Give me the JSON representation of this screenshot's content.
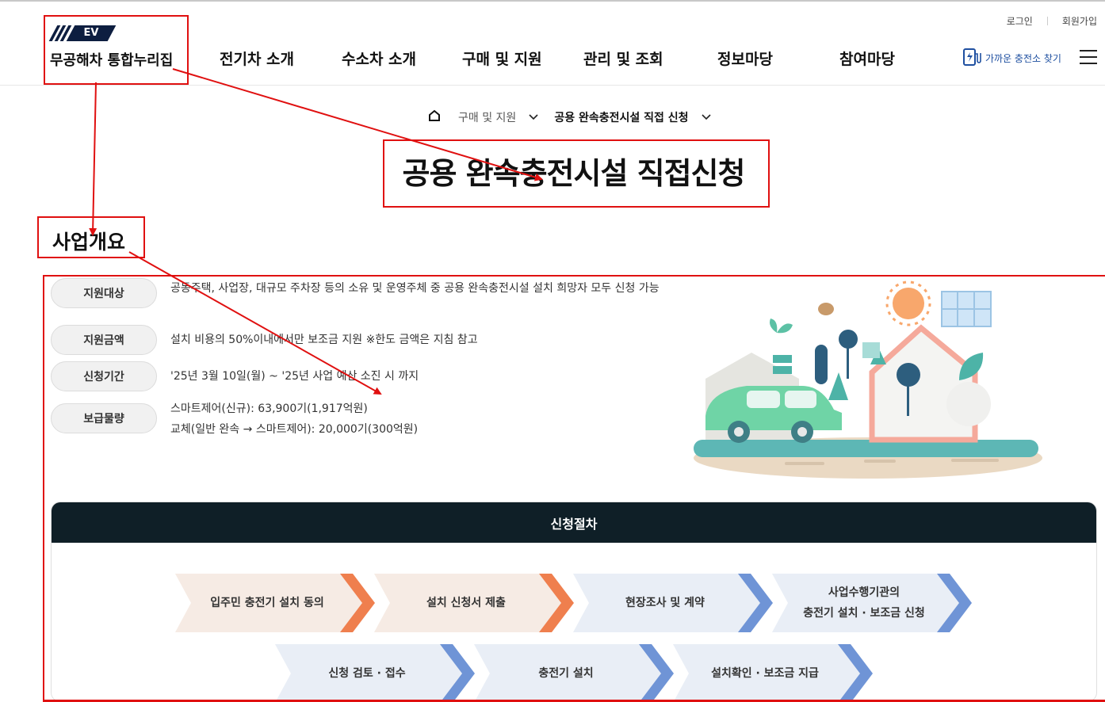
{
  "header": {
    "logo_badge": "EV",
    "logo_text": "무공해차 통합누리집",
    "util": {
      "login": "로그인",
      "signup": "회원가입"
    },
    "nav": [
      "전기차 소개",
      "수소차 소개",
      "구매 및 지원",
      "관리 및 조회",
      "정보마당",
      "참여마당"
    ],
    "charger_find": "가까운 충전소 찾기"
  },
  "breadcrumb": {
    "item1": "구매 및 지원",
    "item2": "공용 완속충전시설 직접 신청"
  },
  "page_title": "공용 완속충전시설 직접신청",
  "section_title": "사업개요",
  "overview": [
    {
      "label": "지원대상",
      "desc": "공동주택, 사업장, 대규모 주차장 등의 소유 및 운영주체 중 공용 완속충전시설 설치 희망자 모두 신청 가능"
    },
    {
      "label": "지원금액",
      "desc": "설치 비용의 50%이내에서만 보조금 지원 ※한도 금액은 지침 참고"
    },
    {
      "label": "신청기간",
      "desc": "'25년 3월 10일(월) ~ '25년 사업 예산 소진 시 까지"
    },
    {
      "label": "보급물량",
      "desc_line1": "스마트제어(신규): 63,900기(1,917억원)",
      "desc_line2": "교체(일반 완속 → 스마트제어): 20,000기(300억원)"
    }
  ],
  "process": {
    "title": "신청절차",
    "steps": [
      {
        "line1": "입주민 충전기 설치 동의",
        "line2": ""
      },
      {
        "line1": "설치 신청서 제출",
        "line2": ""
      },
      {
        "line1": "현장조사 및 계약",
        "line2": ""
      },
      {
        "line1": "사업수행기관의",
        "line2": "충전기 설치 · 보조금 신청"
      },
      {
        "line1": "신청 검토 · 접수",
        "line2": ""
      },
      {
        "line1": "충전기 설치",
        "line2": ""
      },
      {
        "line1": "설치확인 · 보조금 지급",
        "line2": ""
      }
    ]
  },
  "colors": {
    "annotation": "#e01010",
    "step_warm_bg": "#f6ebe4",
    "step_warm_arrow": "#ef7f4e",
    "step_cool_bg": "#e9eef6",
    "step_cool_arrow": "#6f94d6",
    "process_header": "#0f1f27"
  },
  "icons": [
    "home-icon",
    "chevron-down-icon",
    "charger-icon",
    "hamburger-menu-icon"
  ]
}
